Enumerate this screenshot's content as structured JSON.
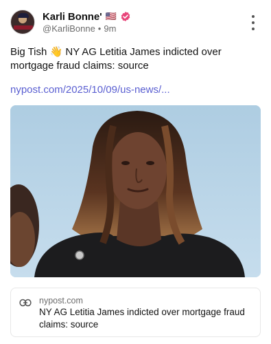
{
  "author": {
    "display_name": "Karli Bonne'",
    "flag": "🇺🇸",
    "handle": "@KarliBonne",
    "separator": "•",
    "time_ago": "9m",
    "verified_color": "#e8457a"
  },
  "post": {
    "text": "Big Tish 👋 NY AG Letitia James indicted over mortgage fraud claims: source",
    "link_text": "nypost.com/2025/10/09/us-news/..."
  },
  "media": {
    "icon": "photo"
  },
  "link_card": {
    "icon": "link-icon",
    "domain": "nypost.com",
    "title": "NY AG Letitia James indicted over mortgage fraud claims: source"
  },
  "colors": {
    "link": "#5a5fd1",
    "muted": "#6b6b6b"
  }
}
